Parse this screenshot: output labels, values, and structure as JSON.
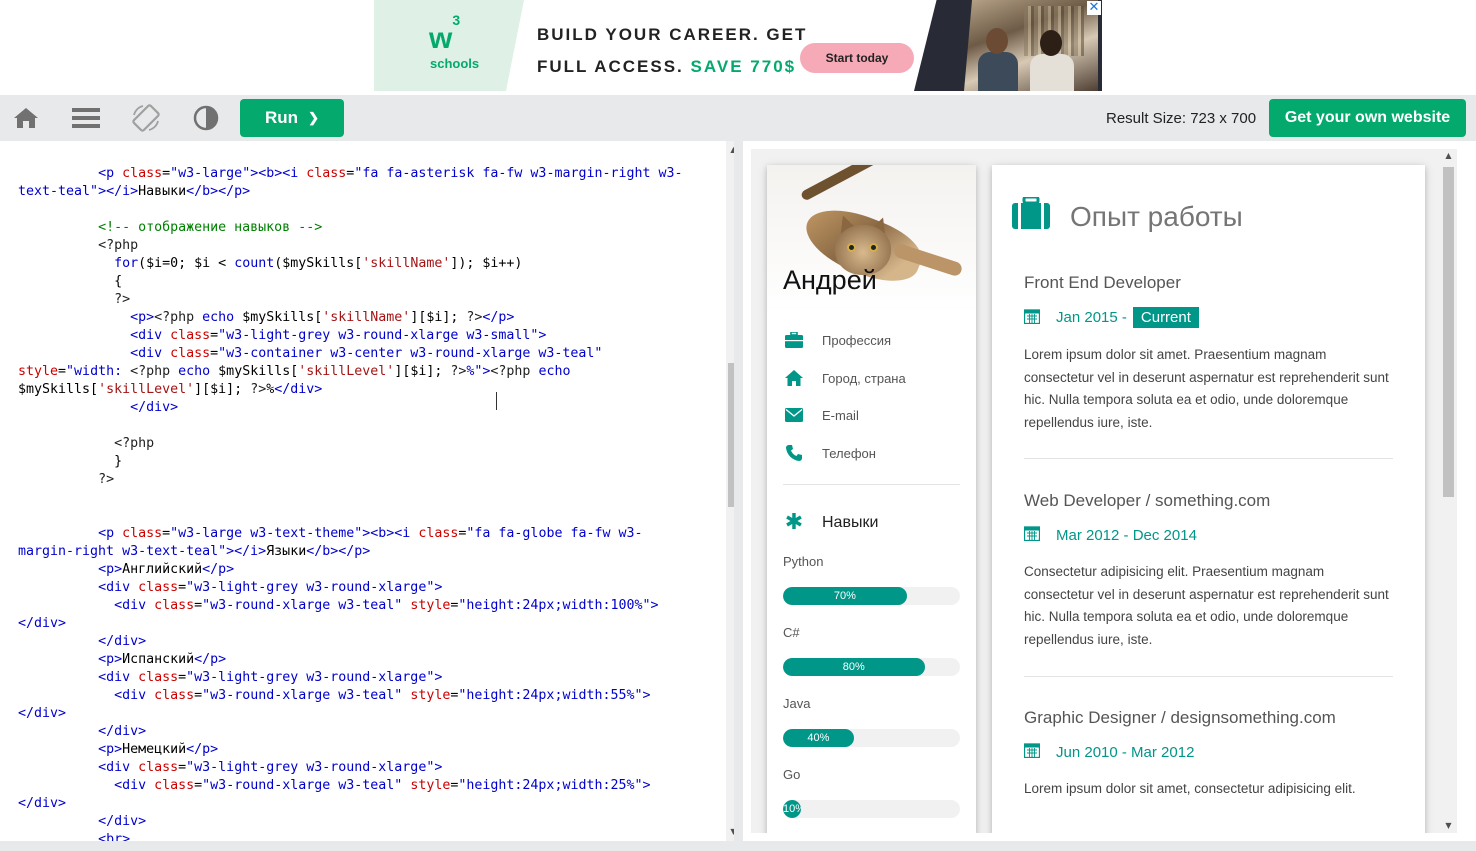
{
  "ad": {
    "logo_mark": "w",
    "logo_sup": "3",
    "logo_text": "schools",
    "line1": "BUILD YOUR CAREER. GET",
    "line2_prefix": "FULL ACCESS.",
    "line2_save": "SAVE 770$",
    "cta": "Start today",
    "close": "✕"
  },
  "toolbar": {
    "icons": [
      "home-icon",
      "menu-icon",
      "rotate-icon",
      "contrast-icon"
    ],
    "run_label": "Run",
    "run_chevron": "❯",
    "result_size": "Result Size: 723 x 700",
    "own_website_label": "Get your own website"
  },
  "editor": {
    "language": "php/html",
    "scroll_up": "▲",
    "scroll_down": "▼"
  },
  "result": {
    "scroll_up": "▲",
    "scroll_down": "▼",
    "profile": {
      "name": "Андрей",
      "info": [
        {
          "icon": "briefcase-icon",
          "label": "Профессия"
        },
        {
          "icon": "home-icon",
          "label": "Город, страна"
        },
        {
          "icon": "envelope-icon",
          "label": "E-mail"
        },
        {
          "icon": "phone-icon",
          "label": "Телефон"
        }
      ],
      "skills_title": "Навыки",
      "skills": [
        {
          "name": "Python",
          "level": 70,
          "label": "70%"
        },
        {
          "name": "C#",
          "level": 80,
          "label": "80%"
        },
        {
          "name": "Java",
          "level": 40,
          "label": "40%"
        },
        {
          "name": "Go",
          "level": 10,
          "label": "10%"
        }
      ]
    },
    "experience": {
      "title": "Опыт работы",
      "jobs": [
        {
          "title": "Front End Developer",
          "date": "Jan 2015 -",
          "current": "Current",
          "desc": "Lorem ipsum dolor sit amet. Praesentium magnam consectetur vel in deserunt aspernatur est reprehenderit sunt hic. Nulla tempora soluta ea et odio, unde doloremque repellendus iure, iste."
        },
        {
          "title": "Web Developer / something.com",
          "date": "Mar 2012 - Dec 2014",
          "current": "",
          "desc": "Consectetur adipisicing elit. Praesentium magnam consectetur vel in deserunt aspernatur est reprehenderit sunt hic. Nulla tempora soluta ea et odio, unde doloremque repellendus iure, iste."
        },
        {
          "title": "Graphic Designer / designsomething.com",
          "date": "Jun 2010 - Mar 2012",
          "current": "",
          "desc": "Lorem ipsum dolor sit amet, consectetur adipisicing elit."
        }
      ]
    }
  },
  "colors": {
    "brand_green": "#04aa6d",
    "teal": "#009688",
    "toolbar_bg": "#e7e9eb"
  }
}
